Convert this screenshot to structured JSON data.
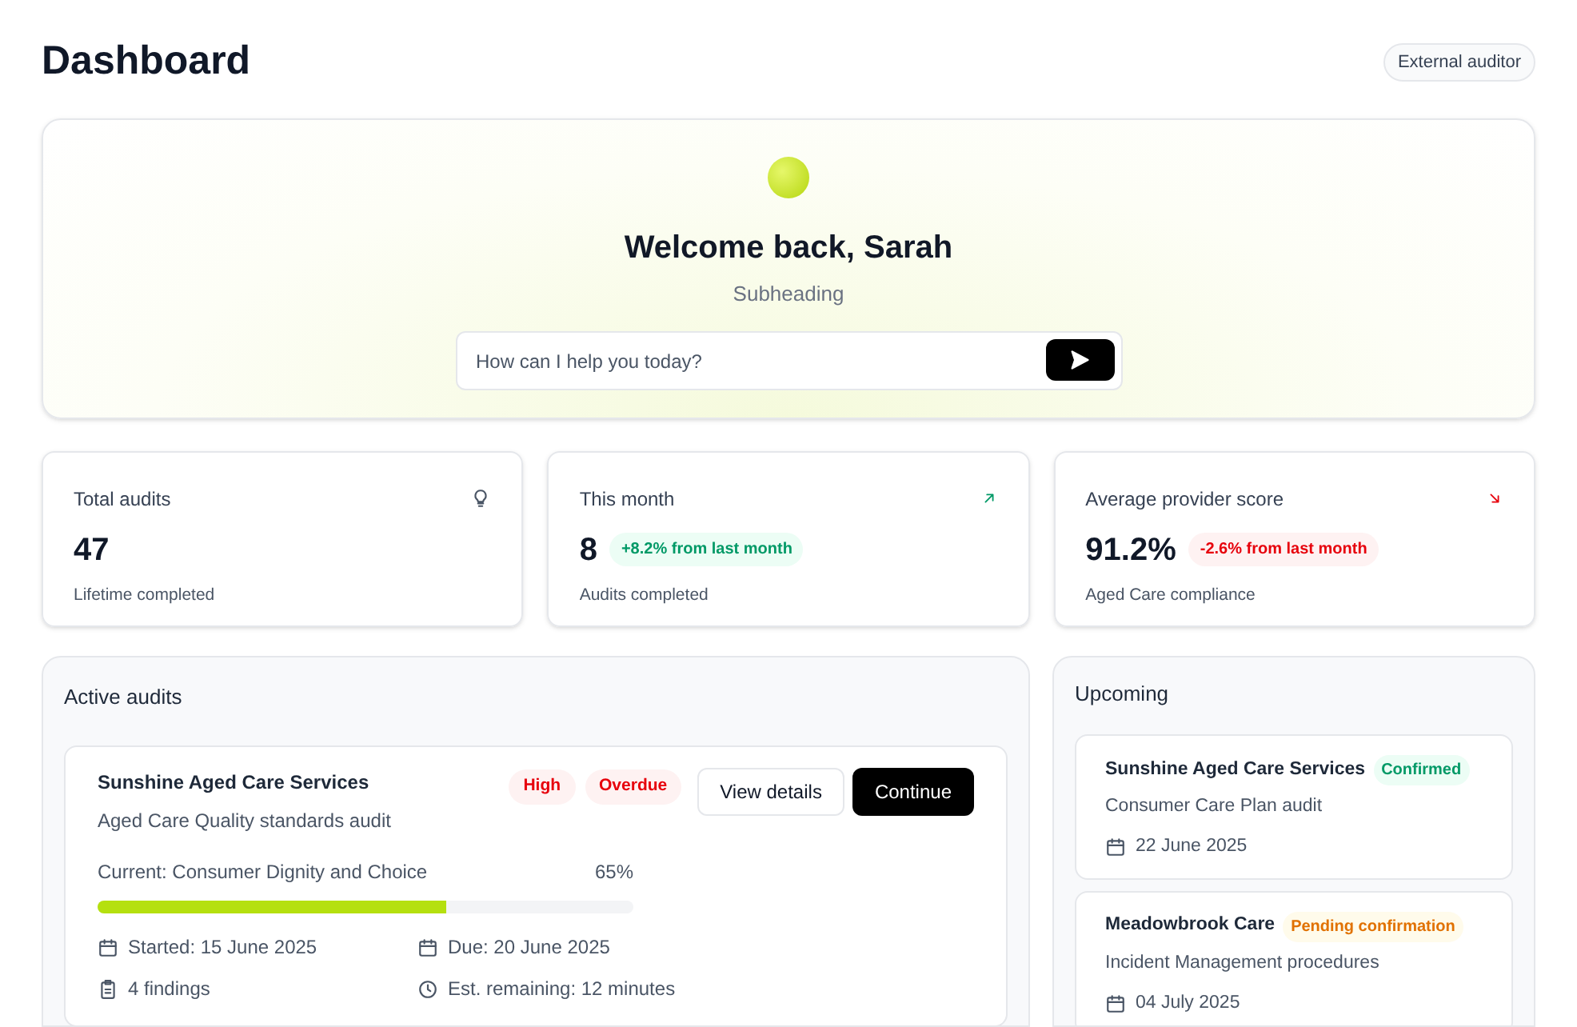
{
  "header": {
    "title": "Dashboard",
    "role_badge": "External auditor"
  },
  "hero": {
    "heading": "Welcome back, Sarah",
    "subheading": "Subheading",
    "prompt": {
      "placeholder": "How can I help you today?"
    }
  },
  "stats": [
    {
      "label": "Total audits",
      "value": "47",
      "caption": "Lifetime completed",
      "kind": "count"
    },
    {
      "label": "This month",
      "value": "8",
      "change": "+8.2% from last month",
      "kind": "up",
      "caption": "Audits completed"
    },
    {
      "label": "Average provider score",
      "value": "91.2%",
      "change": "-2.6% from last month",
      "kind": "down",
      "caption": "Aged Care compliance"
    }
  ],
  "active_audits": {
    "title": "Active audits",
    "items": [
      {
        "provider": "Sunshine Aged Care Services",
        "audit": "Aged Care Quality standards audit",
        "badges": [
          {
            "label": "High",
            "kind": "danger"
          },
          {
            "label": "Overdue",
            "kind": "danger"
          }
        ],
        "buttons": [
          "View details",
          "Continue"
        ],
        "current": "Current: Consumer Dignity and Choice",
        "percent": "65%",
        "level": 0.65,
        "details": [
          {
            "kind": "calendar",
            "text": "Started: 15 June 2025"
          },
          {
            "kind": "calendar",
            "text": "Due: 20 June 2025"
          },
          {
            "kind": "clipboard",
            "text": "4 findings"
          },
          {
            "kind": "clock",
            "text": "Est. remaining: 12 minutes"
          }
        ]
      }
    ]
  },
  "upcoming": {
    "title": "Upcoming",
    "items": [
      {
        "provider": "Sunshine Aged Care Services",
        "status": "Confirmed",
        "kind": "success",
        "audit": "Consumer Care Plan audit",
        "date": "22 June 2025"
      },
      {
        "provider": "Meadowbrook Care",
        "status": "Pending confirmation",
        "kind": "warning",
        "audit": "Incident Management procedures",
        "date": "04 July 2025"
      }
    ]
  }
}
